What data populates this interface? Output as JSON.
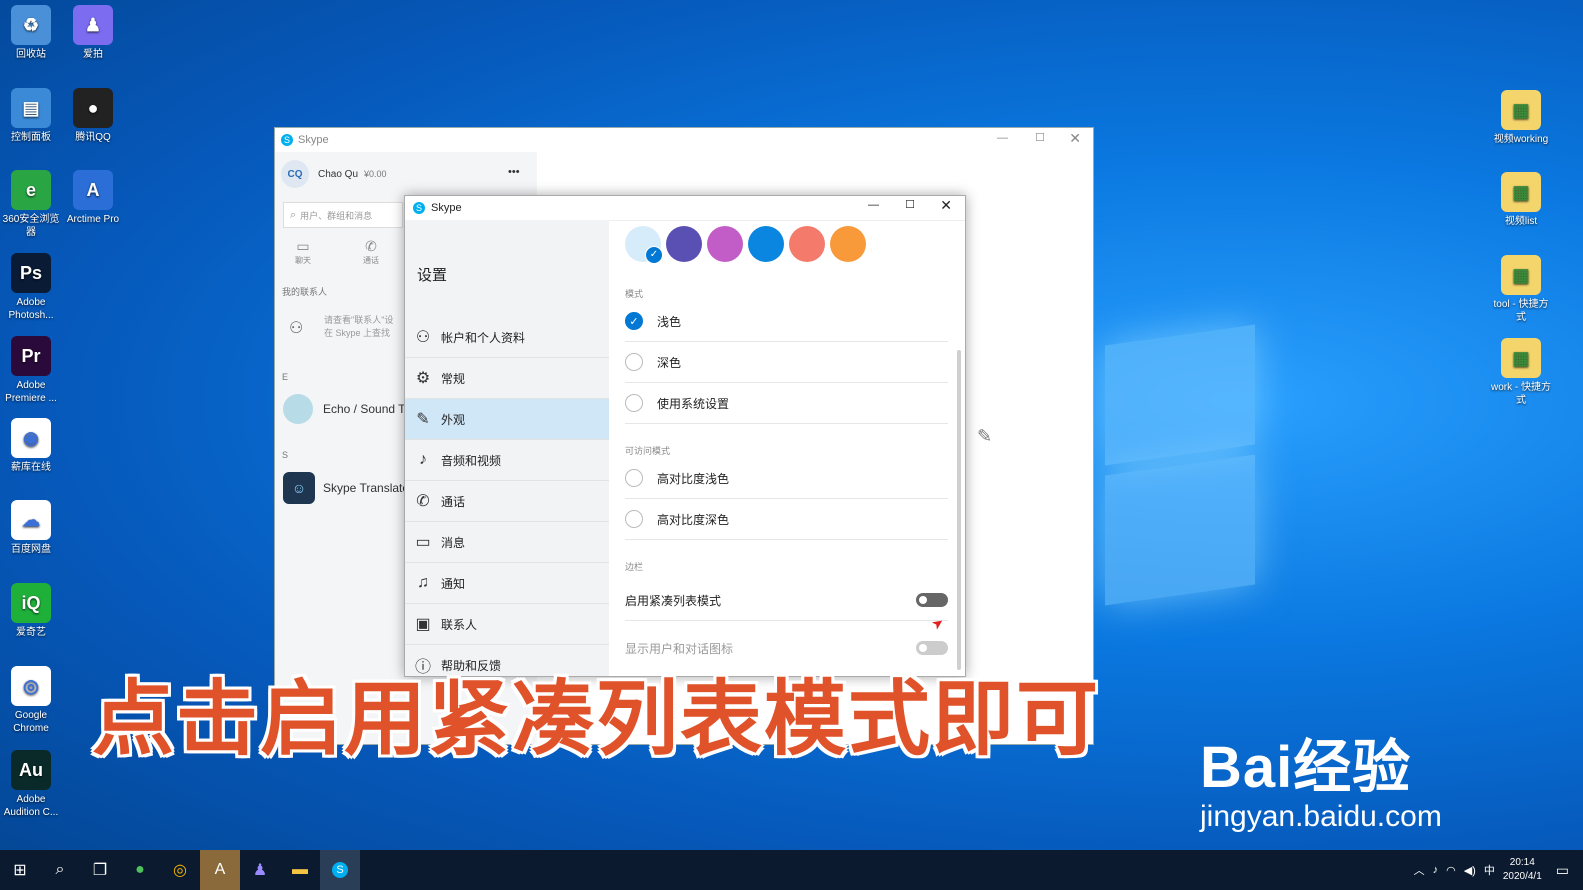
{
  "desktop": {
    "left_icons": [
      {
        "name": "recycle-bin-icon",
        "label": "回收站",
        "color": "#4a90d9",
        "glyph": "♻"
      },
      {
        "name": "aipai-icon",
        "label": "爱拍",
        "color": "#7b6cf0",
        "glyph": "♟"
      },
      {
        "name": "control-panel-icon",
        "label": "控制面板",
        "color": "#3a8ad8",
        "glyph": "▤"
      },
      {
        "name": "qq-icon",
        "label": "腾讯QQ",
        "color": "#222",
        "glyph": "●"
      },
      {
        "name": "360-browser-icon",
        "label": "360安全浏览器",
        "color": "#29a643",
        "glyph": "e"
      },
      {
        "name": "arctime-icon",
        "label": "Arctime Pro",
        "color": "#2b6ed8",
        "glyph": "A"
      },
      {
        "name": "photoshop-icon",
        "label": "Adobe Photosh...",
        "color": "#0a1b36",
        "glyph": "Ps"
      },
      {
        "name": "premiere-icon",
        "label": "Adobe Premiere ...",
        "color": "#2a0a3a",
        "glyph": "Pr"
      },
      {
        "name": "pepsi-icon",
        "label": "薪库在线",
        "color": "#fff",
        "glyph": "◉"
      },
      {
        "name": "baidu-netdisk-icon",
        "label": "百度网盘",
        "color": "#fff",
        "glyph": "☁"
      },
      {
        "name": "iqiyi-icon",
        "label": "爱奇艺",
        "color": "#1fb03a",
        "glyph": "iQ"
      },
      {
        "name": "chrome-icon",
        "label": "Google Chrome",
        "color": "#fff",
        "glyph": "◎"
      },
      {
        "name": "audition-icon",
        "label": "Adobe Audition C...",
        "color": "#0a2a2a",
        "glyph": "Au"
      }
    ],
    "right_icons": [
      {
        "name": "folder-icon",
        "label": "视频working"
      },
      {
        "name": "folder-icon",
        "label": "视频list"
      },
      {
        "name": "folder-icon",
        "label": "tool - 快捷方式"
      },
      {
        "name": "folder-icon",
        "label": "work - 快捷方式"
      }
    ]
  },
  "skype_main": {
    "title": "Skype",
    "user_initials": "CQ",
    "user_name": "Chao Qu",
    "balance": "¥0.00",
    "more": "•••",
    "search_placeholder": "用户、群组和消息",
    "tab_chat": "聊天",
    "tab_calls": "通话",
    "contacts_header": "我的联系人",
    "hint_line1": "请查看\"联系人\"设",
    "hint_line2": "在 Skype 上查找",
    "letter_e": "E",
    "contact_echo": "Echo / Sound T",
    "letter_s": "S",
    "contact_translator": "Skype Translato"
  },
  "dialog": {
    "title": "Skype",
    "heading": "设置",
    "menu": [
      {
        "icon": "person-icon",
        "glyph": "⚇",
        "label": "帐户和个人资料"
      },
      {
        "icon": "gear-icon",
        "glyph": "⚙",
        "label": "常规"
      },
      {
        "icon": "wand-icon",
        "glyph": "✎",
        "label": "外观"
      },
      {
        "icon": "microphone-icon",
        "glyph": "♪",
        "label": "音频和视频"
      },
      {
        "icon": "phone-icon",
        "glyph": "✆",
        "label": "通话"
      },
      {
        "icon": "message-icon",
        "glyph": "▭",
        "label": "消息"
      },
      {
        "icon": "bell-icon",
        "glyph": "♫",
        "label": "通知"
      },
      {
        "icon": "contacts-icon",
        "glyph": "▣",
        "label": "联系人"
      },
      {
        "icon": "info-icon",
        "glyph": "ⓘ",
        "label": "帮助和反馈"
      }
    ],
    "colors": [
      "#d6ecfb",
      "#5a4fb3",
      "#c25dc7",
      "#0a86e0",
      "#f47b6b",
      "#f89a3a"
    ],
    "mode_label": "模式",
    "mode_options": [
      "浅色",
      "深色",
      "使用系统设置"
    ],
    "access_label": "可访问模式",
    "access_options": [
      "高对比度浅色",
      "高对比度深色"
    ],
    "sidebar_label": "边栏",
    "compact_label": "启用紧凑列表模式",
    "show_icons_label": "显示用户和对话图标"
  },
  "overlay_caption": "点击启用紧凑列表模式即可",
  "watermark": {
    "brand": "Bai经验",
    "url": "jingyan.baidu.com"
  },
  "taskbar": {
    "time": "20:14",
    "date": "2020/4/1",
    "ime": "中"
  }
}
